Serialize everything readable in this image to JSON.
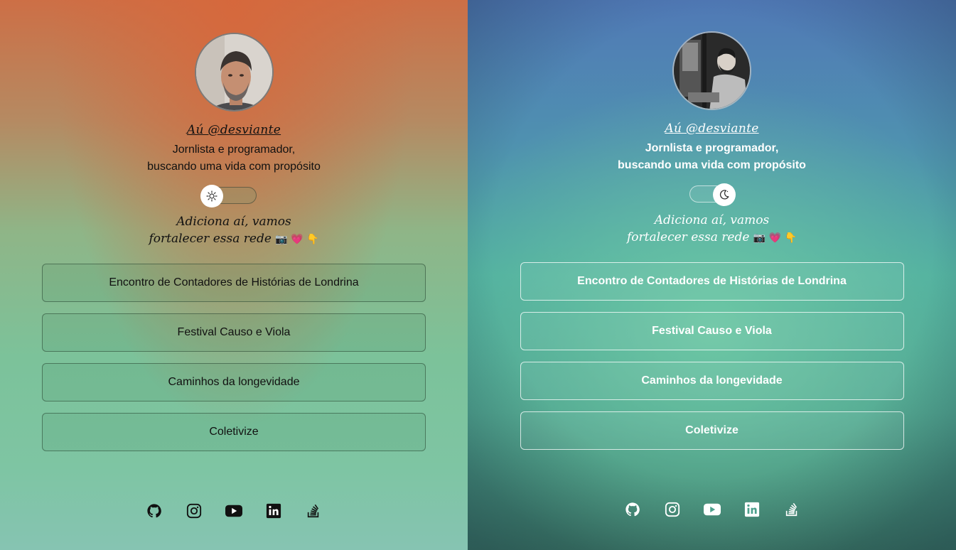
{
  "profile": {
    "handle": "Aú @desviante",
    "bio_line1": "Jornlista e programador,",
    "bio_line2": "buscando uma vida com propósito",
    "tagline_line1": "Adiciona aí, vamos",
    "tagline_line2": "fortalecer essa rede",
    "tagline_emojis": "📷 💗 👇"
  },
  "links": [
    {
      "label": "Encontro de Contadores de Histórias de Londrina"
    },
    {
      "label": "Festival Causo e Viola"
    },
    {
      "label": "Caminhos da longevidade"
    },
    {
      "label": "Coletivize"
    }
  ],
  "theme": {
    "light": {
      "toggle_state": "light",
      "icon": "sun-icon"
    },
    "dark": {
      "toggle_state": "dark",
      "icon": "moon-icon"
    }
  },
  "socials": [
    {
      "name": "github-icon"
    },
    {
      "name": "instagram-icon"
    },
    {
      "name": "youtube-icon"
    },
    {
      "name": "linkedin-icon"
    },
    {
      "name": "stackoverflow-icon"
    }
  ]
}
